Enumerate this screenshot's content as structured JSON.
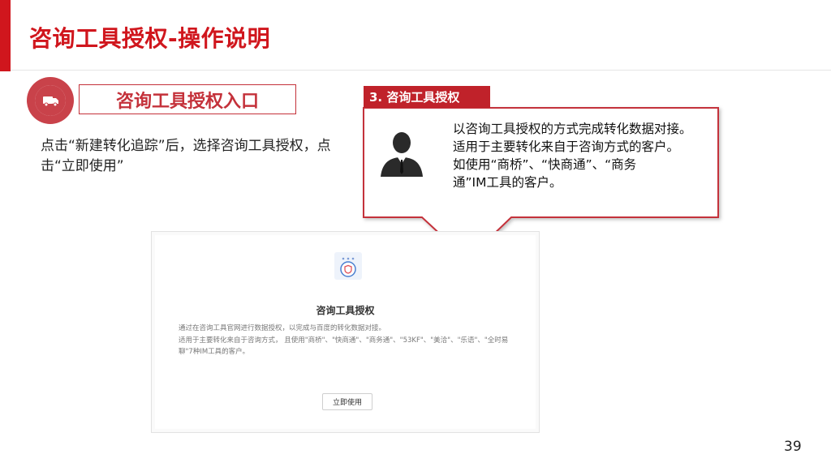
{
  "slide": {
    "title": "咨询工具授权-操作说明",
    "page_number": "39"
  },
  "section": {
    "label": "咨询工具授权入口",
    "icon": "truck-icon"
  },
  "instruction": {
    "text": "点击“新建转化追踪”后，选择咨询工具授权，点击“立即使用”"
  },
  "callout": {
    "tag": "3. 咨询工具授权",
    "lines": [
      "以咨询工具授权的方式完成转化数据对接。",
      "适用于主要转化来自于咨询方式的客户。",
      "如使用“商桥”、“快商通”、“商务",
      "通”IM工具的客户。"
    ],
    "avatar_icon": "businessman-icon"
  },
  "mock": {
    "heading": "咨询工具授权",
    "desc_line1": "通过在咨询工具官网进行数据授权，以完成与百度的转化数据对接。",
    "desc_line2": "适用于主要转化来自于咨询方式， 且使用\"商桥\"、\"快商通\"、\"商务通\"、\"53KF\"、\"美洽\"、\"乐语\"、\"全时易聊\"7种IM工具的客户。",
    "button": "立即使用",
    "logo_icon": "shield-icon"
  },
  "colors": {
    "accent": "#d0161d",
    "badge": "#c9424a",
    "tag": "#c0222a",
    "callout_border": "#c4313a"
  }
}
